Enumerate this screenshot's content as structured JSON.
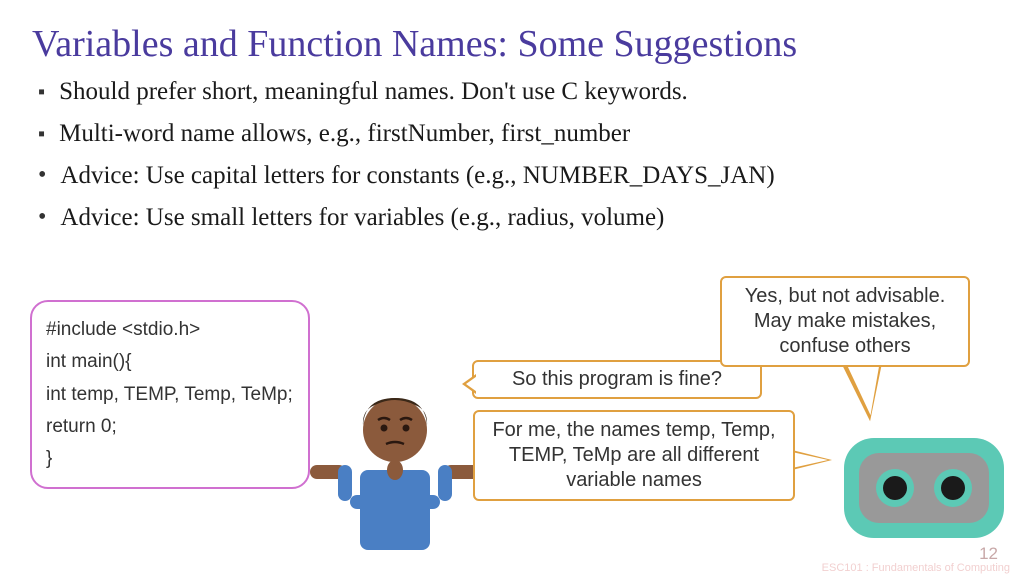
{
  "title": "Variables and Function Names: Some Suggestions",
  "bullets": [
    "Should prefer short, meaningful names. Don't use C keywords.",
    "Multi-word name allows, e.g., firstNumber, first_number",
    "Advice: Use capital letters for constants (e.g., NUMBER_DAYS_JAN)",
    "Advice: Use small letters for variables (e.g., radius, volume)"
  ],
  "code": {
    "l1": "#include <stdio.h>",
    "l2": "int main(){",
    "l3": "int temp, TEMP, Temp, TeMp;",
    "l4": "return 0;",
    "l5": "}"
  },
  "speech": {
    "q": "So this program is fine?",
    "a1": "Yes, but not advisable. May make mistakes, confuse others",
    "a2": "For me, the names temp, Temp, TEMP, TeMp are all different variable names"
  },
  "pageNumber": "12",
  "watermark": "ESC101 : Fundamentals of Computing"
}
